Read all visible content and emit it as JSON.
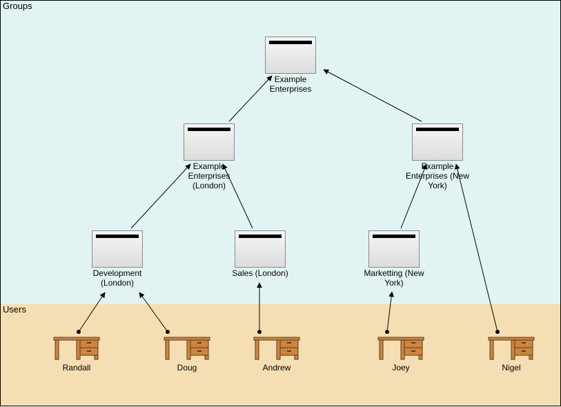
{
  "regions": {
    "groups_label": "Groups",
    "users_label": "Users"
  },
  "groups": {
    "root": {
      "label": "Example\nEnterprises"
    },
    "london": {
      "label": "Example\nEnterprises\n(London)"
    },
    "newyork": {
      "label": "Example\nEnterprises (New\nYork)"
    },
    "dev_london": {
      "label": "Development\n(London)"
    },
    "sales_london": {
      "label": "Sales (London)"
    },
    "marketing_ny": {
      "label": "Marketting (New\nYork)"
    }
  },
  "users": {
    "randall": {
      "label": "Randall"
    },
    "doug": {
      "label": "Doug"
    },
    "andrew": {
      "label": "Andrew"
    },
    "joey": {
      "label": "Joey"
    },
    "nigel": {
      "label": "Nigel"
    }
  },
  "edges": [
    {
      "from": "dev_london",
      "to": "london"
    },
    {
      "from": "sales_london",
      "to": "london"
    },
    {
      "from": "london",
      "to": "root"
    },
    {
      "from": "marketing_ny",
      "to": "newyork"
    },
    {
      "from": "newyork",
      "to": "root"
    },
    {
      "from": "randall",
      "to": "dev_london"
    },
    {
      "from": "doug",
      "to": "dev_london"
    },
    {
      "from": "andrew",
      "to": "sales_london"
    },
    {
      "from": "joey",
      "to": "marketing_ny"
    },
    {
      "from": "nigel",
      "to": "newyork"
    }
  ]
}
